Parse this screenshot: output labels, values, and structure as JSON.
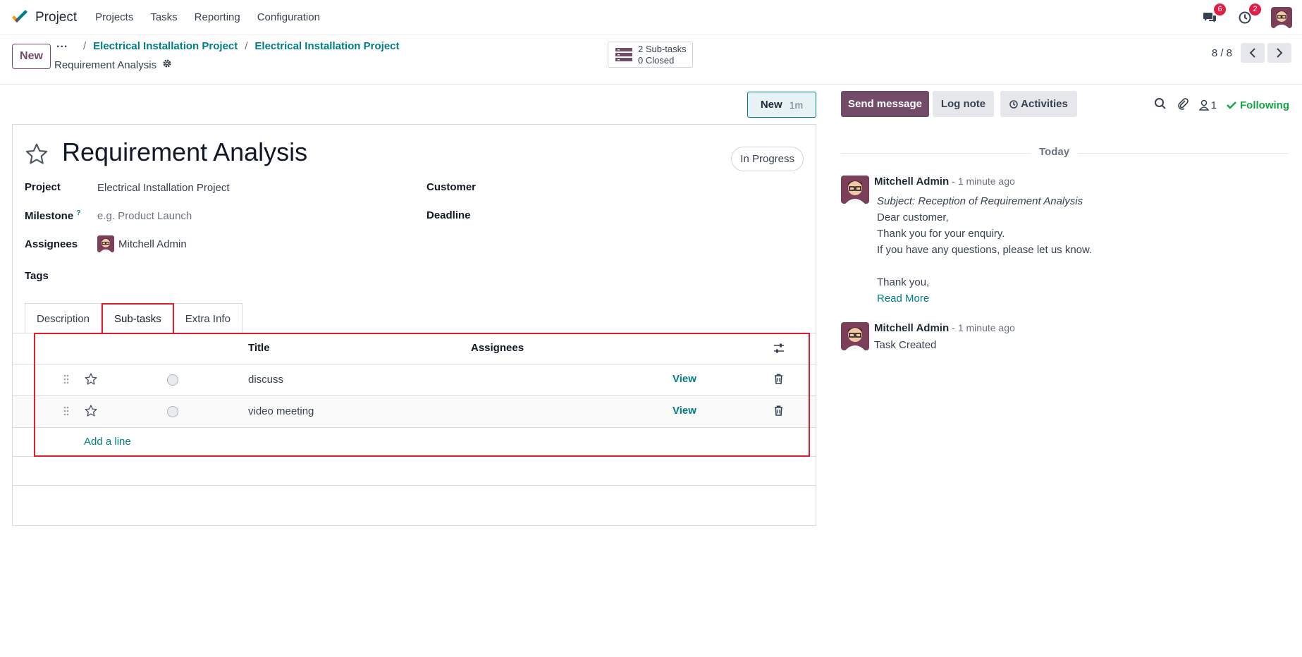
{
  "navbar": {
    "app_name": "Project",
    "menu": [
      "Projects",
      "Tasks",
      "Reporting",
      "Configuration"
    ],
    "messages_count": "6",
    "activities_count": "2"
  },
  "control_panel": {
    "new_label": "New",
    "breadcrumb_dots": "...",
    "breadcrumbs": [
      "Electrical Installation Project",
      "Electrical Installation Project"
    ],
    "record_name": "Requirement Analysis",
    "subtasks_count": "2 Sub-tasks",
    "subtasks_closed": "0 Closed",
    "pager_value": "8 / 8"
  },
  "form": {
    "stage_label": "New",
    "stage_duration": "1m",
    "title": "Requirement Analysis",
    "state": "In Progress",
    "fields": {
      "project_label": "Project",
      "project_value": "Electrical Installation Project",
      "milestone_label": "Milestone",
      "milestone_help": "?",
      "milestone_placeholder": "e.g. Product Launch",
      "assignees_label": "Assignees",
      "assignee_name": "Mitchell Admin",
      "tags_label": "Tags",
      "customer_label": "Customer",
      "deadline_label": "Deadline"
    },
    "tabs": [
      "Description",
      "Sub-tasks",
      "Extra Info"
    ],
    "active_tab": "Sub-tasks",
    "subtasks": {
      "columns": [
        "Title",
        "Assignees"
      ],
      "rows": [
        {
          "title": "discuss",
          "action": "View"
        },
        {
          "title": "video meeting",
          "action": "View"
        }
      ],
      "add_line": "Add a line"
    }
  },
  "chatter": {
    "send_message": "Send message",
    "log_note": "Log note",
    "activities": "Activities",
    "followers_count": "1",
    "following_label": "Following",
    "date_separator": "Today",
    "messages": [
      {
        "author": "Mitchell Admin",
        "date": "- 1 minute ago",
        "subject": "Subject: Reception of Requirement Analysis",
        "lines": [
          "Dear customer,",
          "Thank you for your enquiry.",
          "If you have any questions, please let us know.",
          "",
          "Thank you,"
        ],
        "read_more": "Read More"
      },
      {
        "author": "Mitchell Admin",
        "date": "- 1 minute ago",
        "body": "Task Created"
      }
    ]
  },
  "colors": {
    "brand": "#714b67",
    "link": "#017e84",
    "highlight": "#e11d2e",
    "success": "#16a34a",
    "badge": "#e11d48"
  }
}
